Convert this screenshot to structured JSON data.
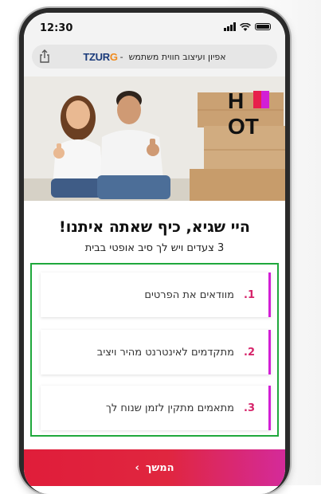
{
  "status_bar": {
    "time": "12:30"
  },
  "browser": {
    "page_title": "אפיון ועיצוב חווית משתמש",
    "separator": "-",
    "logo_text": "TZUR",
    "logo_accent": "G"
  },
  "hero": {
    "logo": "HOT"
  },
  "heading": {
    "title": "היי שגיא, כיף שאתה איתנו!",
    "subtitle": "3 צעדים ויש לך סיב אופטי בבית"
  },
  "steps": [
    {
      "number": "1.",
      "text": "מוודאים את הפרטים"
    },
    {
      "number": "2.",
      "text": "מתקדמים לאינטרנט מהיר ויציב"
    },
    {
      "number": "3.",
      "text": "מתאמים מתקין לזמן שנוח לך"
    }
  ],
  "cta": {
    "label": "המשך",
    "chevron": "›"
  },
  "colors": {
    "accent_red": "#e01d3a",
    "accent_magenta": "#d21fd6",
    "highlight_box": "#1fa83c",
    "step_number": "#d6246a"
  },
  "icons": {
    "share": "share-icon",
    "signal": "signal-icon",
    "wifi": "wifi-icon",
    "battery": "battery-icon",
    "chevron": "chevron-left-icon"
  }
}
